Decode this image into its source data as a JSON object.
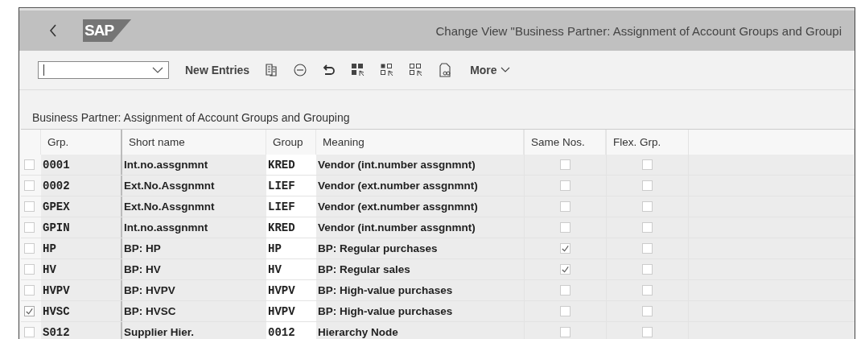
{
  "header": {
    "logo": "SAP",
    "title": "Change View \"Business Partner: Assignment of Account Groups and Groupi"
  },
  "toolbar": {
    "new_entries": "New Entries",
    "more": "More"
  },
  "section_title": "Business Partner: Assignment of Account Groups and Grouping",
  "table": {
    "columns": [
      "Grp.",
      "Short name",
      "Group",
      "Meaning",
      "Same Nos.",
      "Flex. Grp."
    ],
    "rows": [
      {
        "selected": false,
        "grp": "0001",
        "short_name": "Int.no.assgnmnt",
        "group": "KRED",
        "meaning": "Vendor (int.number assgnmnt)",
        "same_nos": false,
        "flex_grp": false
      },
      {
        "selected": false,
        "grp": "0002",
        "short_name": "Ext.No.Assgnmnt",
        "group": "LIEF",
        "meaning": "Vendor (ext.number assgnmnt)",
        "same_nos": false,
        "flex_grp": false
      },
      {
        "selected": false,
        "grp": "GPEX",
        "short_name": "Ext.No.Assgnmnt",
        "group": "LIEF",
        "meaning": "Vendor (ext.number assgnmnt)",
        "same_nos": false,
        "flex_grp": false
      },
      {
        "selected": false,
        "grp": "GPIN",
        "short_name": "Int.no.assgnmnt",
        "group": "KRED",
        "meaning": "Vendor (int.number assgnmnt)",
        "same_nos": false,
        "flex_grp": false
      },
      {
        "selected": false,
        "grp": "HP",
        "short_name": "BP: HP",
        "group": "HP",
        "meaning": "BP: Regular purchases",
        "same_nos": true,
        "flex_grp": false
      },
      {
        "selected": false,
        "grp": "HV",
        "short_name": "BP: HV",
        "group": "HV",
        "meaning": "BP: Regular sales",
        "same_nos": true,
        "flex_grp": false
      },
      {
        "selected": false,
        "grp": "HVPV",
        "short_name": "BP: HVPV",
        "group": "HVPV",
        "meaning": "BP: High-value purchases",
        "same_nos": false,
        "flex_grp": false
      },
      {
        "selected": true,
        "grp": "HVSC",
        "short_name": "BP: HVSC",
        "group": "HVPV",
        "meaning": "BP: High-value purchases",
        "same_nos": false,
        "flex_grp": false
      },
      {
        "selected": false,
        "grp": "S012",
        "short_name": "Supplier Hier.",
        "group": "0012",
        "meaning": "Hierarchy Node",
        "same_nos": false,
        "flex_grp": false
      }
    ]
  }
}
